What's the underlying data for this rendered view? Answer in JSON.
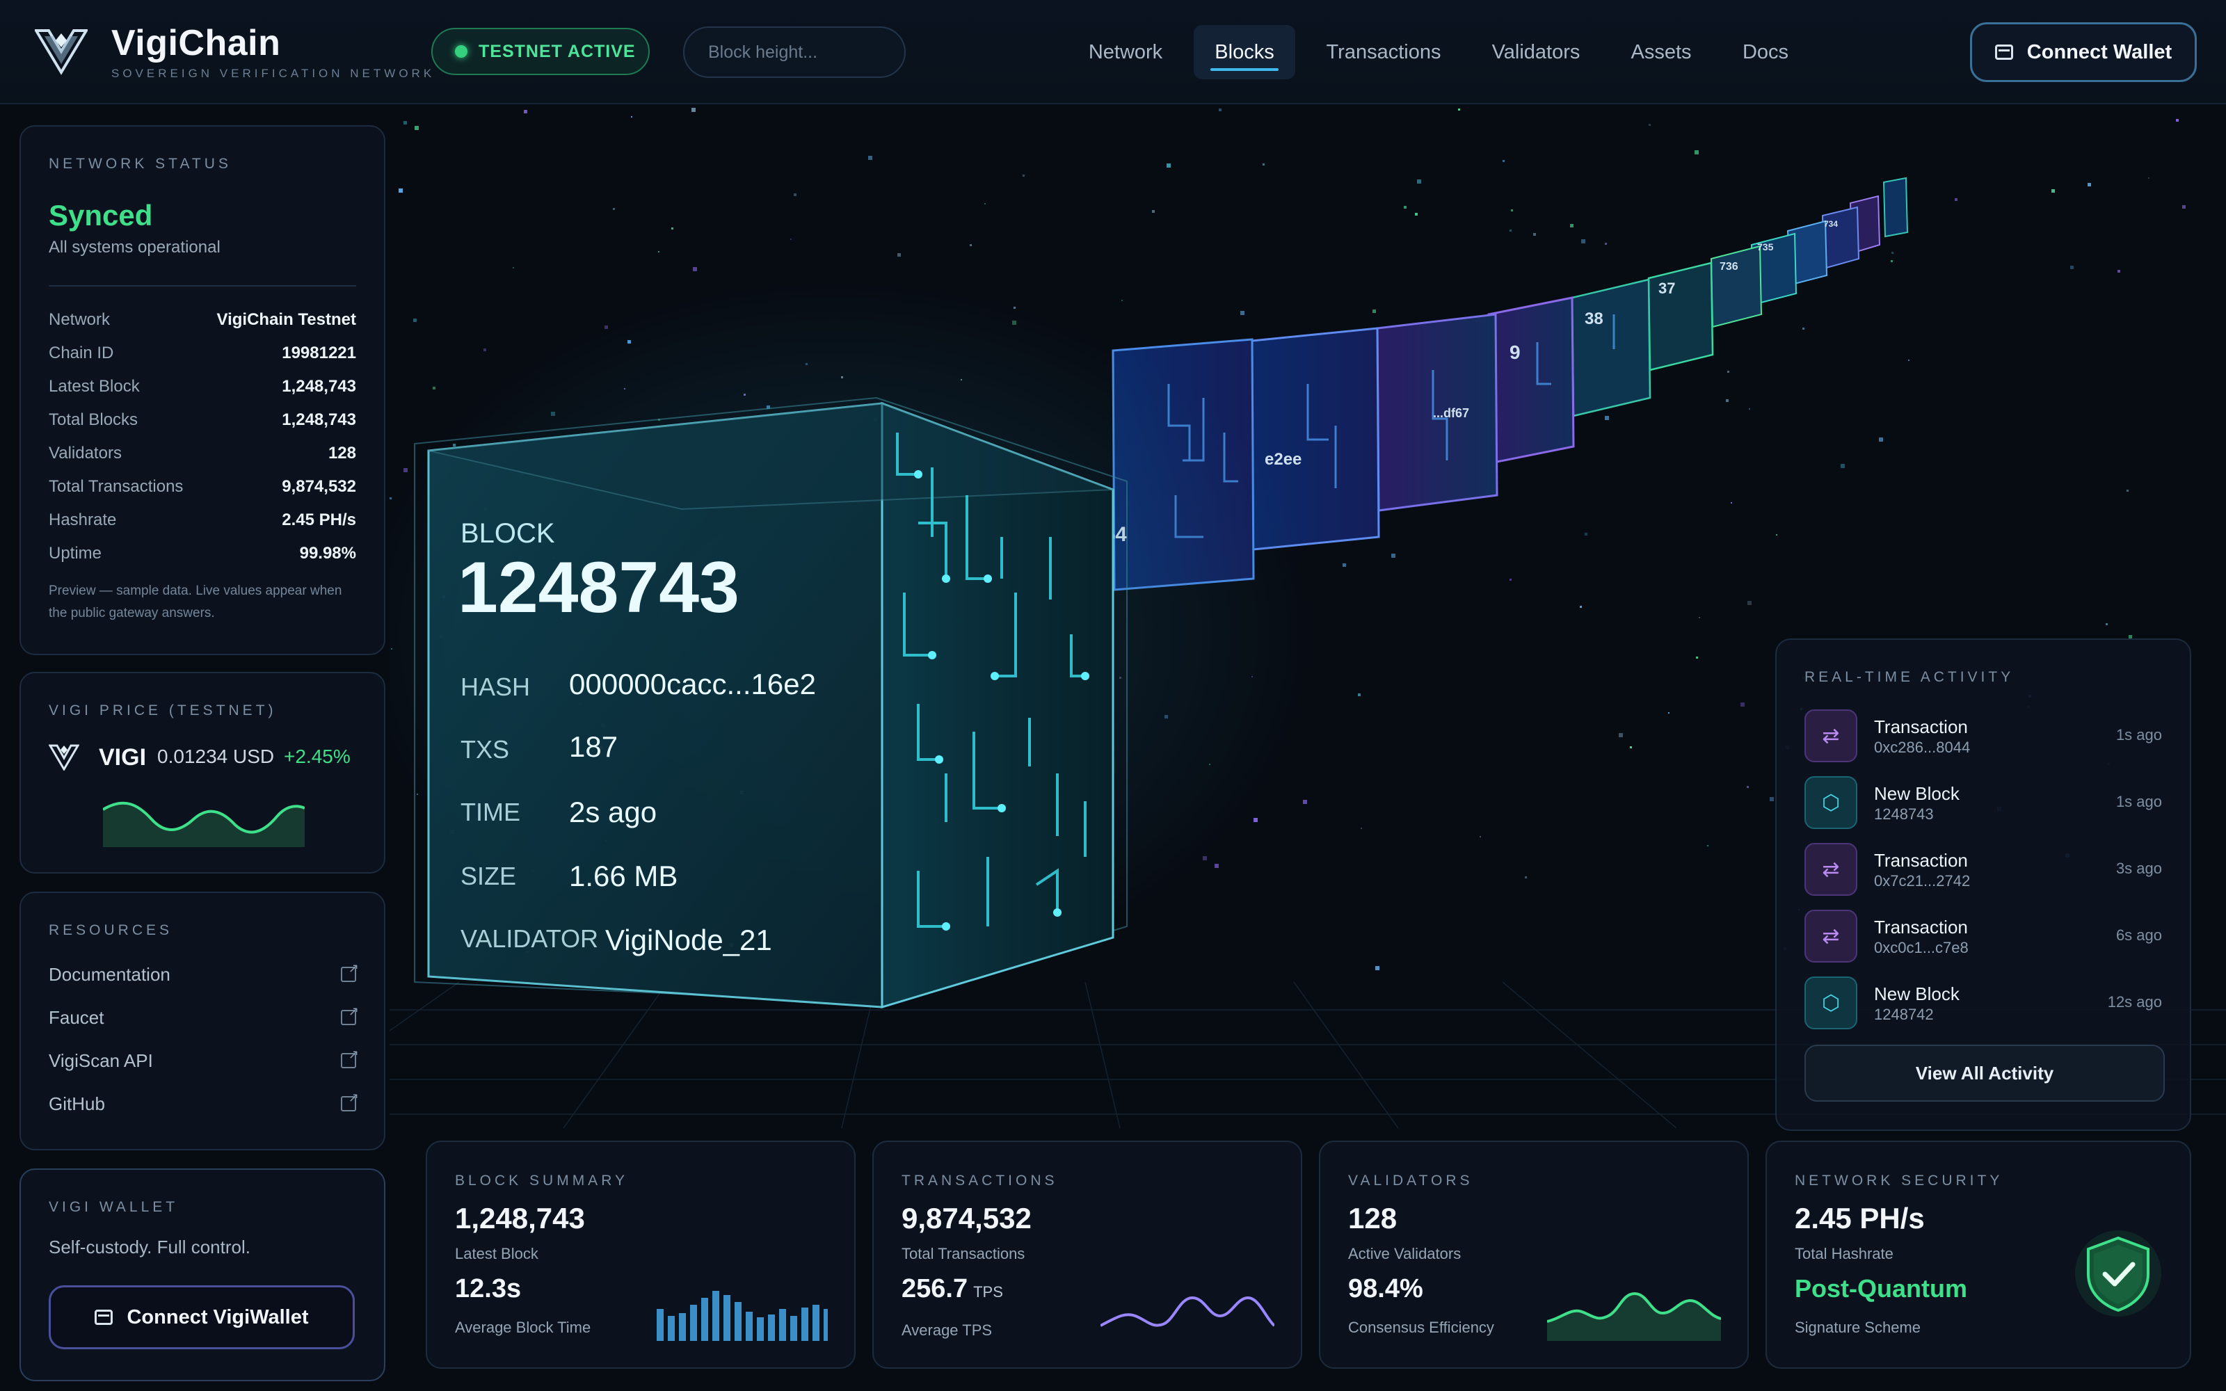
{
  "brand": {
    "name": "VigiChain",
    "tagline": "SOVEREIGN VERIFICATION NETWORK"
  },
  "header": {
    "testnet_label": "TESTNET ACTIVE",
    "search_placeholder": "Block height...",
    "nav": [
      "Network",
      "Blocks",
      "Transactions",
      "Validators",
      "Assets",
      "Docs"
    ],
    "nav_active": "Blocks",
    "connect_label": "Connect Wallet"
  },
  "network_status": {
    "title": "NETWORK STATUS",
    "state": "Synced",
    "state_sub": "All systems operational",
    "rows": [
      {
        "k": "Network",
        "v": "VigiChain Testnet"
      },
      {
        "k": "Chain ID",
        "v": "19981221"
      },
      {
        "k": "Latest Block",
        "v": "1,248,743"
      },
      {
        "k": "Total Blocks",
        "v": "1,248,743"
      },
      {
        "k": "Validators",
        "v": "128"
      },
      {
        "k": "Total Transactions",
        "v": "9,874,532"
      },
      {
        "k": "Hashrate",
        "v": "2.45 PH/s"
      },
      {
        "k": "Uptime",
        "v": "99.98%"
      }
    ],
    "note": "Preview — sample data. Live values appear when the public gateway answers."
  },
  "price": {
    "title": "VIGI PRICE (TESTNET)",
    "symbol": "VIGI",
    "value": "0.01234 USD",
    "change": "+2.45%"
  },
  "resources": {
    "title": "RESOURCES",
    "items": [
      "Documentation",
      "Faucet",
      "VigiScan API",
      "GitHub"
    ]
  },
  "wallet": {
    "title": "VIGI WALLET",
    "subtitle": "Self-custody. Full control.",
    "button": "Connect VigiWallet"
  },
  "block": {
    "label": "BLOCK",
    "number": "1248743",
    "fields": [
      {
        "k": "HASH",
        "v": "000000cacc...16e2"
      },
      {
        "k": "TXS",
        "v": "187"
      },
      {
        "k": "TIME",
        "v": "2s ago"
      },
      {
        "k": "SIZE",
        "v": "1.66 MB"
      },
      {
        "k": "VALIDATOR",
        "v": "VigiNode_21"
      }
    ],
    "chain_labels": [
      "354",
      "e2ee",
      "...df67",
      "9",
      "38",
      "37",
      "736",
      "735",
      "734"
    ]
  },
  "activity": {
    "title": "REAL-TIME ACTIVITY",
    "items": [
      {
        "type": "tx",
        "title": "Transaction",
        "sub": "0xc286...8044",
        "time": "1s ago"
      },
      {
        "type": "blk",
        "title": "New Block",
        "sub": "1248743",
        "time": "1s ago"
      },
      {
        "type": "tx",
        "title": "Transaction",
        "sub": "0x7c21...2742",
        "time": "3s ago"
      },
      {
        "type": "tx",
        "title": "Transaction",
        "sub": "0xc0c1...c7e8",
        "time": "6s ago"
      },
      {
        "type": "blk",
        "title": "New Block",
        "sub": "1248742",
        "time": "12s ago"
      }
    ],
    "view_all": "View All Activity"
  },
  "cards": {
    "block_summary": {
      "title": "BLOCK SUMMARY",
      "big": "1,248,743",
      "big_label": "Latest Block",
      "big2": "12.3s",
      "big2_label": "Average Block Time"
    },
    "transactions": {
      "title": "TRANSACTIONS",
      "big": "9,874,532",
      "big_label": "Total Transactions",
      "big2": "256.7",
      "big2_unit": "TPS",
      "big2_label": "Average TPS"
    },
    "validators": {
      "title": "VALIDATORS",
      "big": "128",
      "big_label": "Active Validators",
      "big2": "98.4%",
      "big2_label": "Consensus Efficiency"
    },
    "security": {
      "title": "NETWORK SECURITY",
      "big": "2.45 PH/s",
      "big_label": "Total Hashrate",
      "big2": "Post-Quantum",
      "big2_label": "Signature Scheme"
    }
  },
  "colors": {
    "accent_green": "#3fe08a",
    "accent_cyan": "#46d7e6",
    "accent_purple": "#b98af2",
    "accent_blue": "#3fb9ee"
  }
}
